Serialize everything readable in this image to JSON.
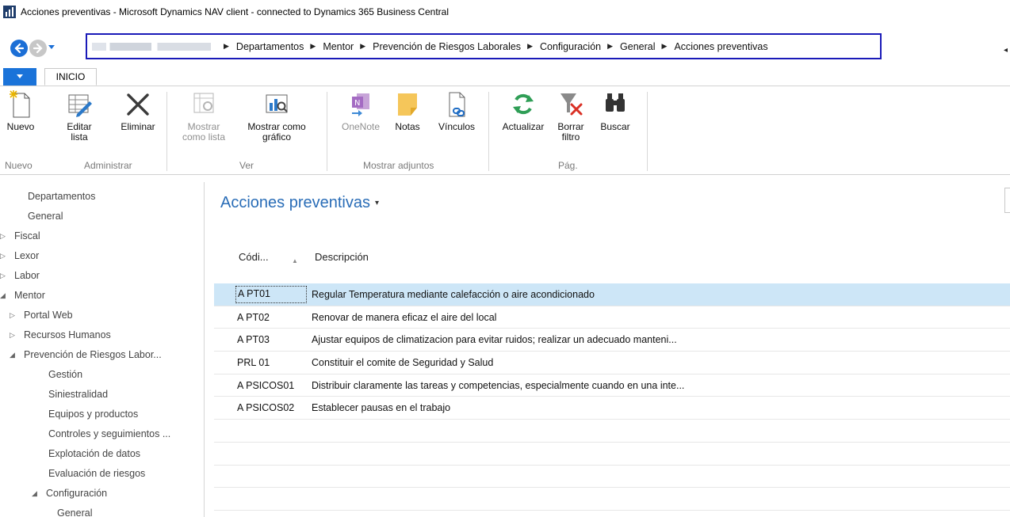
{
  "window": {
    "title": "Acciones preventivas - Microsoft Dynamics NAV client - connected to Dynamics 365 Business Central"
  },
  "breadcrumb": {
    "items": [
      "Departamentos",
      "Mentor",
      "Prevención de Riesgos Laborales",
      "Configuración",
      "General",
      "Acciones preventivas"
    ]
  },
  "ribbon": {
    "tab_home": "INICIO",
    "buttons": {
      "nuevo": "Nuevo",
      "editar_lista_1": "Editar",
      "editar_lista_2": "lista",
      "eliminar": "Eliminar",
      "mostrar_lista_1": "Mostrar",
      "mostrar_lista_2": "como lista",
      "mostrar_grafico_1": "Mostrar como",
      "mostrar_grafico_2": "gráfico",
      "onenote": "OneNote",
      "notas": "Notas",
      "vinculos": "Vínculos",
      "actualizar": "Actualizar",
      "borrar_filtro_1": "Borrar",
      "borrar_filtro_2": "filtro",
      "buscar": "Buscar"
    },
    "groups": {
      "nuevo": "Nuevo",
      "administrar": "Administrar",
      "ver": "Ver",
      "mostrar_adjuntos": "Mostrar adjuntos",
      "pag": "Pág."
    }
  },
  "navpane": {
    "items": [
      {
        "label": "Departamentos"
      },
      {
        "label": "General"
      },
      {
        "label": "Fiscal"
      },
      {
        "label": "Lexor"
      },
      {
        "label": "Labor"
      },
      {
        "label": "Mentor"
      },
      {
        "label": "Portal Web"
      },
      {
        "label": "Recursos Humanos"
      },
      {
        "label": "Prevención de Riesgos Labor..."
      },
      {
        "label": "Gestión"
      },
      {
        "label": "Siniestralidad"
      },
      {
        "label": "Equipos y productos"
      },
      {
        "label": "Controles y seguimientos ..."
      },
      {
        "label": "Explotación de datos"
      },
      {
        "label": "Evaluación de riesgos"
      },
      {
        "label": "Configuración"
      },
      {
        "label": "General"
      }
    ]
  },
  "page": {
    "title": "Acciones preventivas",
    "columns": {
      "code": "Códi...",
      "description": "Descripción"
    },
    "rows": [
      {
        "code": "A PT01",
        "description": "Regular Temperatura mediante calefacción o aire acondicionado"
      },
      {
        "code": "A PT02",
        "description": "Renovar de manera eficaz el aire del local"
      },
      {
        "code": "A PT03",
        "description": "Ajustar equipos de climatizacion para evitar ruidos; realizar un adecuado manteni..."
      },
      {
        "code": "PRL 01",
        "description": "Constituir el comite de Seguridad y Salud"
      },
      {
        "code": "A PSICOS01",
        "description": "Distribuir claramente las tareas y competencias, especialmente cuando en una inte..."
      },
      {
        "code": "A PSICOS02",
        "description": "Establecer pausas en el trabajo"
      }
    ]
  },
  "colors": {
    "accent_blue": "#1a73d9",
    "title_blue": "#2a6db7",
    "selection": "#cde6f7",
    "highlight_box": "#1a1ab8"
  }
}
